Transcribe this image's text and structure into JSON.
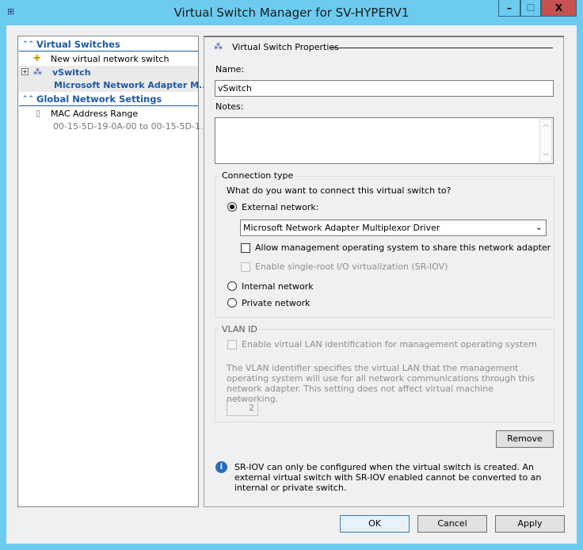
{
  "window": {
    "title": "Virtual Switch Manager for SV-HYPERV1",
    "minimize": "–",
    "maximize": "☐",
    "close": "X"
  },
  "sidebar": {
    "virtual_switches_header": "Virtual Switches",
    "new_switch": "New virtual network switch",
    "vswitch_name": "vSwitch",
    "vswitch_adapter": "Microsoft Network Adapter M...",
    "global_header": "Global Network Settings",
    "mac_label": "MAC Address Range",
    "mac_value": "00-15-5D-19-0A-00 to 00-15-5D-1..."
  },
  "properties": {
    "header": "Virtual Switch Properties",
    "name_label": "Name:",
    "name_value": "vSwitch",
    "notes_label": "Notes:",
    "notes_value": "",
    "connection": {
      "title": "Connection type",
      "question": "What do you want to connect this virtual switch to?",
      "external": "External network:",
      "external_selected": true,
      "adapter_selected": "Microsoft Network Adapter Multiplexor Driver",
      "allow_mgmt": "Allow management operating system to share this network adapter",
      "allow_mgmt_checked": false,
      "sriov": "Enable single-root I/O virtualization (SR-IOV)",
      "sriov_checked": false,
      "internal": "Internal network",
      "private": "Private network"
    },
    "vlan": {
      "title": "VLAN ID",
      "enable": "Enable virtual LAN identification for management operating system",
      "enable_checked": false,
      "desc": "The VLAN identifier specifies the virtual LAN that the management operating system will use for all network communications through this network adapter. This setting does not affect virtual machine networking.",
      "value": "2"
    },
    "remove": "Remove",
    "info": "SR-IOV can only be configured when the virtual switch is created. An external virtual switch with SR-IOV enabled cannot be converted to an internal or private switch."
  },
  "footer": {
    "ok": "OK",
    "cancel": "Cancel",
    "apply": "Apply"
  }
}
